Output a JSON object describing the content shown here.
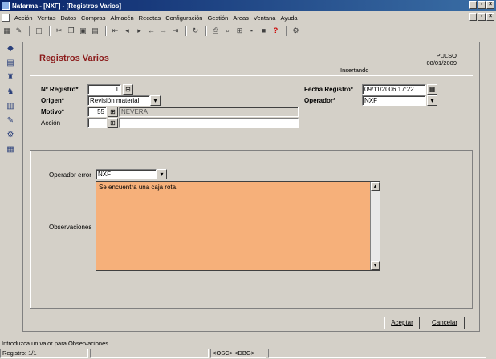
{
  "window": {
    "title": "Nafarma - [NXF] - [Registros Varios]"
  },
  "menu": {
    "items": [
      "Acción",
      "Ventas",
      "Datos",
      "Compras",
      "Almacén",
      "Recetas",
      "Configuración",
      "Gestión",
      "Areas",
      "Ventana",
      "Ayuda"
    ]
  },
  "toolbar": {
    "icons": [
      "grid-icon",
      "edit-icon",
      "preview-icon",
      "cut-icon",
      "copy-icon",
      "paste-icon",
      "first-icon",
      "prev-icon",
      "next-icon",
      "last-icon",
      "new-icon",
      "delete-icon",
      "refresh-icon",
      "print-icon",
      "search-icon",
      "calc-icon",
      "stop-icon",
      "help-icon",
      "config-icon"
    ]
  },
  "form": {
    "title": "Registros Varios",
    "mode": "Insertando",
    "pulso_label": "PULSO",
    "pulso_date": "08/01/2009",
    "labels": {
      "registro": "Nº Registro*",
      "origen": "Origen*",
      "motivo": "Motivo*",
      "accion": "Acción",
      "fecha": "Fecha Registro*",
      "operador": "Operador*",
      "operador_error": "Operador error",
      "observaciones": "Observaciones"
    },
    "values": {
      "registro": "1",
      "origen": "Revisión material",
      "motivo_code": "55",
      "motivo_desc": "NEVERA",
      "accion": "",
      "fecha": "09/11/2006 17:22",
      "operador": "NXF",
      "operador_error": "NXF",
      "observaciones": "Se encuentra una caja rota."
    },
    "buttons": {
      "accept": "Aceptar",
      "cancel": "Cancelar"
    }
  },
  "status": {
    "hint": "Introduzca un valor para Observaciones",
    "record": "Registro: 1/1",
    "osc": "<OSC> <DBG>"
  }
}
